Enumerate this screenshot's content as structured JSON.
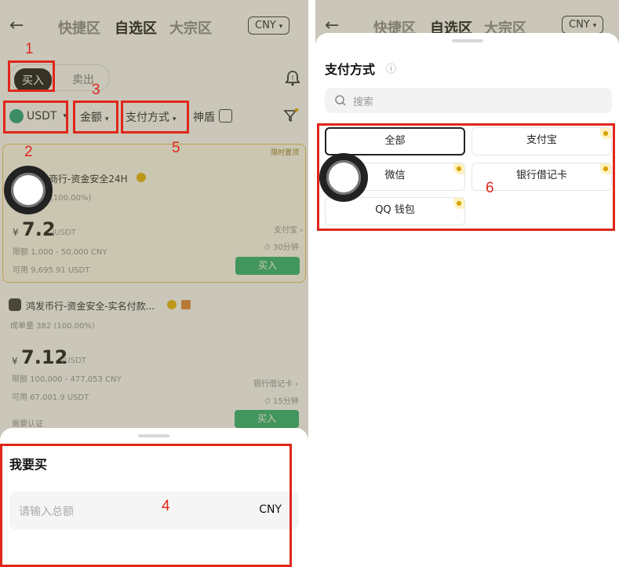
{
  "nav": {
    "back_glyph": "←",
    "tabs": [
      "快捷区",
      "自选区",
      "大宗区"
    ],
    "currency": "CNY",
    "caret": "▾"
  },
  "left": {
    "segment": {
      "buy": "买入",
      "sell": "卖出"
    },
    "filters": {
      "coin": "USDT",
      "amount": "金额",
      "payment": "支付方式",
      "shield": "神盾"
    },
    "cards": [
      {
        "tag": "限时置顶",
        "merchant": "商行-资金安全24H",
        "stats": "(100.00%)",
        "currency_symbol": "¥",
        "price": "7.2",
        "unit": "/USDT",
        "limit": "限额  1,000 - 50,000 CNY",
        "available": "可用  9,695.91 USDT",
        "method": "支付宝 ›",
        "time": "⏱ 30分钟",
        "button": "买入"
      },
      {
        "merchant": "鸿发币行-资金安全-实名付款...",
        "stats": "成单量 382 (100.00%)",
        "currency_symbol": "¥",
        "price": "7.12",
        "unit": "/USDT",
        "limit": "限额  100,000 - 477,053 CNY",
        "available": "可用  67,001.9 USDT",
        "method": "银行借记卡 ›",
        "time": "⏱ 15分钟",
        "auth": "需要认证",
        "button": "买入"
      }
    ],
    "sheet": {
      "title": "我要买",
      "placeholder": "请输入总额",
      "currency": "CNY"
    }
  },
  "right": {
    "sheet": {
      "title": "支付方式",
      "info_glyph": "ⓘ",
      "search_placeholder": "搜索",
      "options": [
        "全部",
        "支付宝",
        "微信",
        "银行借记卡",
        "QQ 钱包"
      ]
    }
  },
  "annotations": [
    "1",
    "2",
    "3",
    "4",
    "5",
    "6"
  ],
  "colors": {
    "annotation_red": "#e0261b",
    "buy_green": "#25b06a",
    "highlight_gold": "#e9c24d"
  }
}
